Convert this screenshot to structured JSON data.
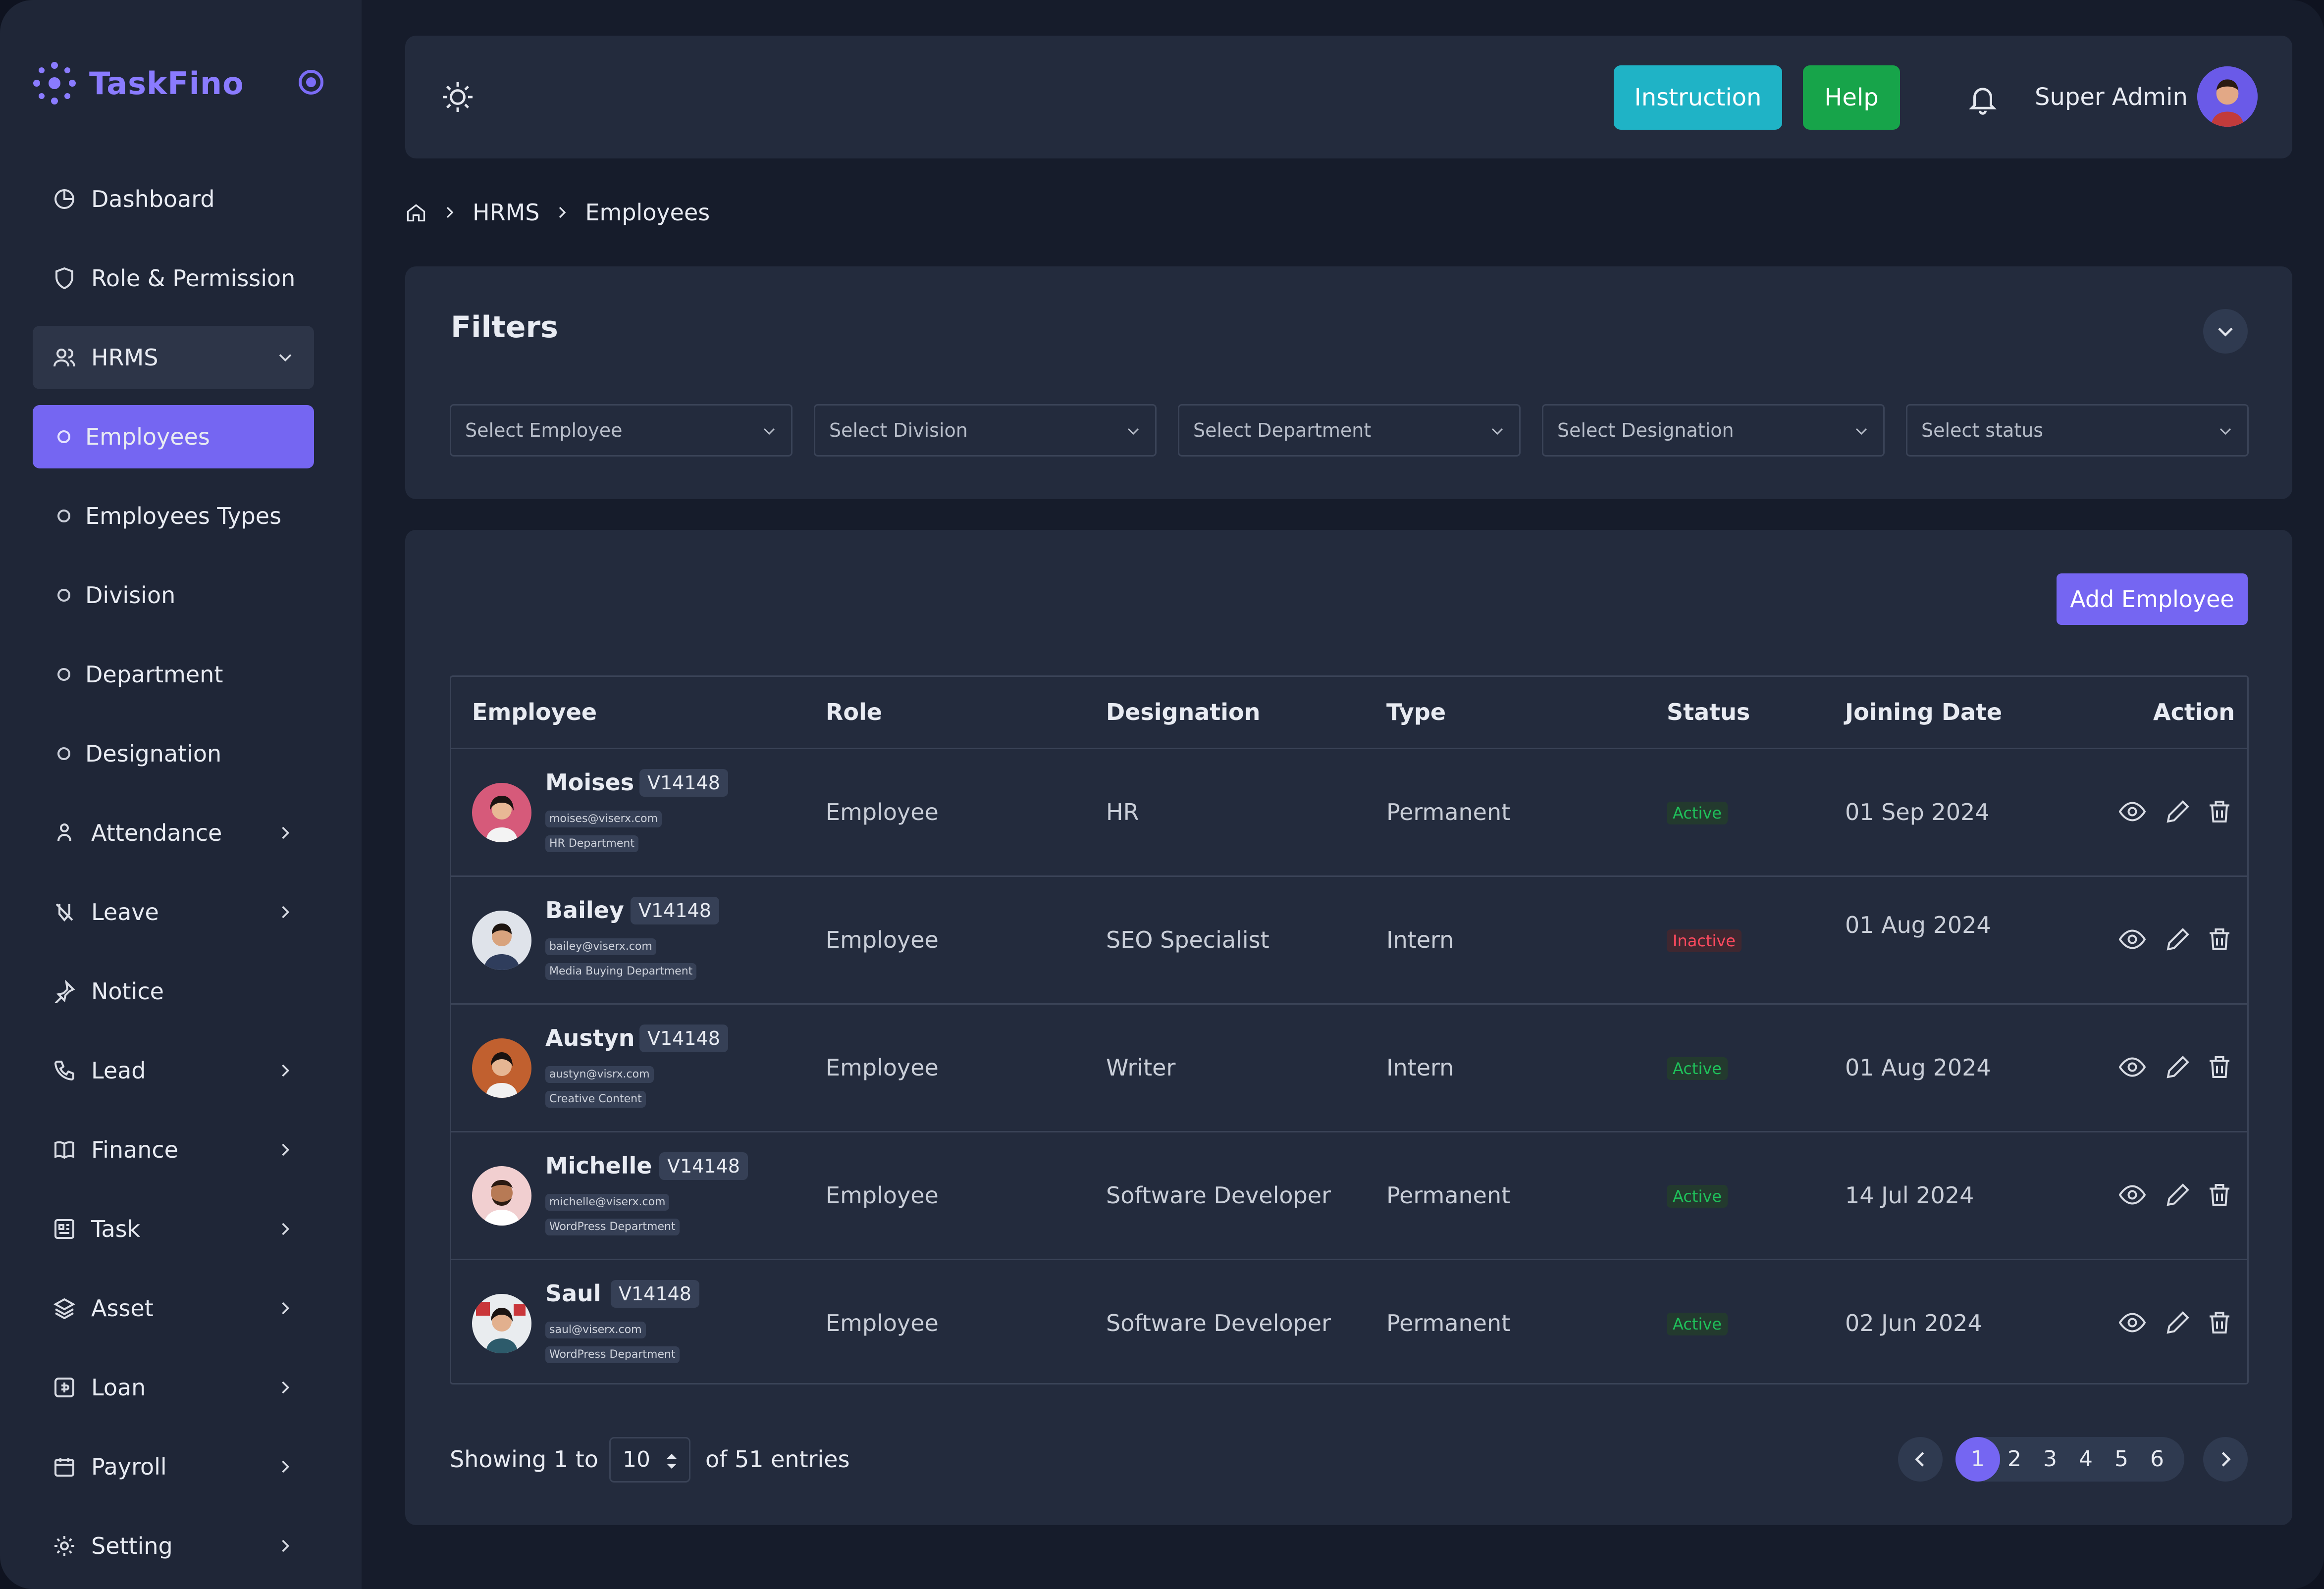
{
  "app": {
    "brand": "TaskFino",
    "accent": "#7566f2"
  },
  "sidebar": {
    "items": [
      {
        "label": "Dashboard",
        "icon": "dashboard-icon"
      },
      {
        "label": "Role & Permission",
        "icon": "shield-icon"
      },
      {
        "label": "HRMS",
        "icon": "users-icon"
      },
      {
        "label": "Employees",
        "icon": "circle-icon"
      },
      {
        "label": "Employees Types",
        "icon": "circle-icon"
      },
      {
        "label": "Division",
        "icon": "circle-icon"
      },
      {
        "label": "Department",
        "icon": "circle-icon"
      },
      {
        "label": "Designation",
        "icon": "circle-icon"
      },
      {
        "label": "Attendance",
        "icon": "person-icon"
      },
      {
        "label": "Leave",
        "icon": "leave-icon"
      },
      {
        "label": "Notice",
        "icon": "pin-icon"
      },
      {
        "label": "Lead",
        "icon": "phone-icon"
      },
      {
        "label": "Finance",
        "icon": "book-icon"
      },
      {
        "label": "Task",
        "icon": "task-icon"
      },
      {
        "label": "Asset",
        "icon": "layers-icon"
      },
      {
        "label": "Loan",
        "icon": "loan-icon"
      },
      {
        "label": "Payroll",
        "icon": "calendar-icon"
      },
      {
        "label": "Setting",
        "icon": "gear-icon"
      }
    ]
  },
  "topbar": {
    "instruction_label": "Instruction",
    "help_label": "Help",
    "user_name": "Super Admin"
  },
  "breadcrumb": {
    "section": "HRMS",
    "page": "Employees"
  },
  "filters": {
    "title": "Filters",
    "employee_placeholder": "Select Employee",
    "division_placeholder": "Select Division",
    "department_placeholder": "Select Department",
    "designation_placeholder": "Select Designation",
    "status_placeholder": "Select status"
  },
  "table": {
    "add_label": "Add Employee",
    "columns": {
      "employee": "Employee",
      "role": "Role",
      "designation": "Designation",
      "type": "Type",
      "status": "Status",
      "joining_date": "Joining Date",
      "action": "Action"
    },
    "rows": [
      {
        "name": "Moises",
        "code": "V14148",
        "email": "moises@viserx.com",
        "department": "HR Department",
        "role": "Employee",
        "designation": "HR",
        "type": "Permanent",
        "status": "Active",
        "joining_date": "01 Sep 2024"
      },
      {
        "name": "Bailey",
        "code": "V14148",
        "email": "bailey@viserx.com",
        "department": "Media Buying Department",
        "role": "Employee",
        "designation": "SEO Specialist",
        "type": "Intern",
        "status": "Inactive",
        "joining_date": "01 Aug 2024"
      },
      {
        "name": "Austyn",
        "code": "V14148",
        "email": "austyn@visrx.com",
        "department": "Creative Content",
        "role": "Employee",
        "designation": "Writer",
        "type": "Intern",
        "status": "Active",
        "joining_date": "01 Aug 2024"
      },
      {
        "name": "Michelle",
        "code": "V14148",
        "email": "michelle@viserx.com",
        "department": "WordPress Department",
        "role": "Employee",
        "designation": "Software Developer",
        "type": "Permanent",
        "status": "Active",
        "joining_date": "14 Jul 2024"
      },
      {
        "name": "Saul",
        "code": "V14148",
        "email": "saul@viserx.com",
        "department": "WordPress Department",
        "role": "Employee",
        "designation": "Software Developer",
        "type": "Permanent",
        "status": "Active",
        "joining_date": "02 Jun 2024"
      }
    ]
  },
  "pagination": {
    "showing_prefix": "Showing 1 to",
    "page_size": "10",
    "of_entries": "of 51 entries",
    "pages": [
      "1",
      "2",
      "3",
      "4",
      "5",
      "6"
    ],
    "current": "1"
  }
}
